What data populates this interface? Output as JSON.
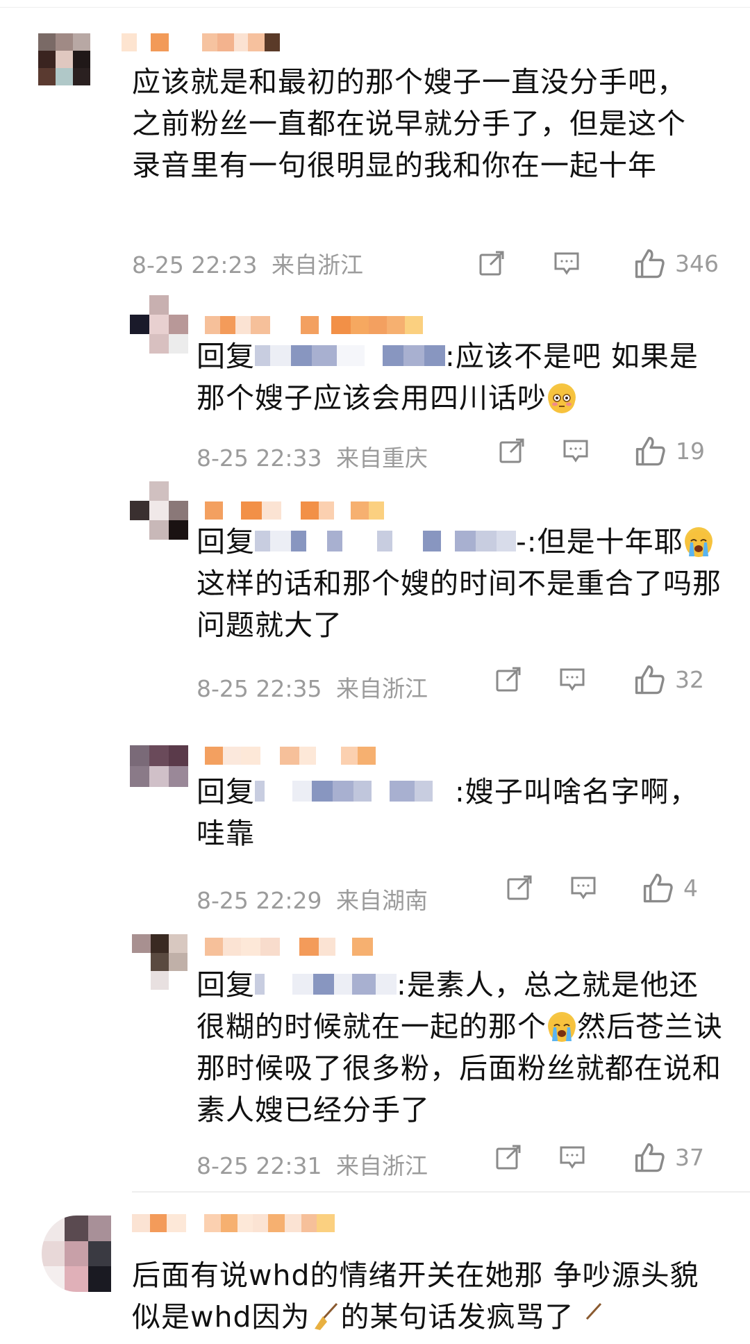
{
  "comments": [
    {
      "text": "应该就是和最初的那个嫂子一直没分手吧，之前粉丝一直都在说早就分手了，但是这个录音里有一句很明显的我和你在一起十年",
      "time": "8-25 22:23",
      "location": "来自浙江",
      "likes": "346"
    }
  ],
  "replies": [
    {
      "reply_prefix": "回复",
      "text": ":应该不是吧 如果是那个嫂子应该会用四川话吵",
      "emoji": "flushed-face",
      "time": "8-25 22:33",
      "location": "来自重庆",
      "likes": "19"
    },
    {
      "reply_prefix": "回复",
      "text_a": "-:但是十年耶",
      "emoji": "loudly-crying-face",
      "text_b": "这样的话和那个嫂的时间不是重合了吗那问题就大了",
      "time": "8-25 22:35",
      "location": "来自浙江",
      "likes": "32"
    },
    {
      "reply_prefix": "回复",
      "text": ":嫂子叫啥名字啊，哇靠",
      "time": "8-25 22:29",
      "location": "来自湖南",
      "likes": "4"
    },
    {
      "reply_prefix": "回复",
      "text_a": ":是素人，总之就是他还很糊的时候就在一起的那个",
      "emoji": "loudly-crying-face",
      "text_b": "然后苍兰诀那时候吸了很多粉，后面粉丝就都在说和素人嫂已经分手了",
      "time": "8-25 22:31",
      "location": "来自浙江",
      "likes": "37"
    }
  ],
  "last_comment": {
    "text_a": "后面有说whd的情绪开关在她那 争吵源头貌似是whd因为",
    "emoji": "broom",
    "text_b": "的某句话发疯骂了"
  },
  "icons": {
    "share": "share-icon",
    "comment": "comment-icon",
    "like": "thumbs-up-icon"
  },
  "colors": {
    "meta_gray": "#9b9b9b",
    "name_orange": "#f0a050",
    "mosaic_blue": "#8896c0"
  }
}
